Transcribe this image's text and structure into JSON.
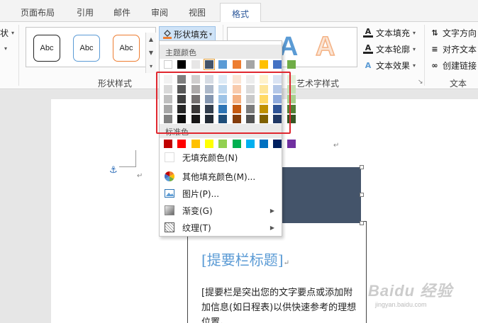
{
  "tabs": [
    {
      "label": "页面布局"
    },
    {
      "label": "引用"
    },
    {
      "label": "邮件"
    },
    {
      "label": "审阅"
    },
    {
      "label": "视图"
    },
    {
      "label": "格式"
    }
  ],
  "ribbon": {
    "left_fragment": "状",
    "shape_styles": {
      "label": "形状样式",
      "buttons": [
        {
          "text": "Abc",
          "border": "#222222"
        },
        {
          "text": "Abc",
          "border": "#5b9bd5"
        },
        {
          "text": "Abc",
          "border": "#ed7d31"
        }
      ],
      "fill_button": "形状填充"
    },
    "wordart": {
      "label": "艺术字样式",
      "letters": [
        {
          "char": "A",
          "color": "#5b9bd5"
        },
        {
          "char": "A",
          "color": "#f4b183"
        }
      ],
      "text_fill": "文本填充",
      "text_outline": "文本轮廓",
      "text_effects": "文本效果"
    },
    "text_group": {
      "label": "文本",
      "direction": "文字方向",
      "align": "对齐文本",
      "link": "创建链接"
    }
  },
  "dropdown": {
    "theme_colors_label": "主题颜色",
    "theme_colors": [
      "#ffffff",
      "#000000",
      "#e7e6e6",
      "#44546a",
      "#5b9bd5",
      "#ed7d31",
      "#a5a5a5",
      "#ffc000",
      "#4472c4",
      "#70ad47"
    ],
    "selected_theme_index": 3,
    "shades": [
      [
        "#f2f2f2",
        "#d9d9d9",
        "#bfbfbf",
        "#a6a6a6",
        "#808080"
      ],
      [
        "#7f7f7f",
        "#595959",
        "#404040",
        "#262626",
        "#0d0d0d"
      ],
      [
        "#d0cece",
        "#aeabab",
        "#757171",
        "#3a3838",
        "#171616"
      ],
      [
        "#d6dce4",
        "#adb9ca",
        "#8496b0",
        "#333f4f",
        "#222a35"
      ],
      [
        "#deebf6",
        "#bdd7ee",
        "#9dc3e6",
        "#2e75b5",
        "#1f4e79"
      ],
      [
        "#fbe5d5",
        "#f8cbad",
        "#f4b183",
        "#c55a11",
        "#833c0b"
      ],
      [
        "#ededed",
        "#dbdbdb",
        "#c9c9c9",
        "#7b7b7b",
        "#525252"
      ],
      [
        "#fff2cc",
        "#fee599",
        "#ffd965",
        "#bf9000",
        "#7f6000"
      ],
      [
        "#dae3f3",
        "#b4c7e7",
        "#8faadc",
        "#2f5496",
        "#203864"
      ],
      [
        "#e2efd9",
        "#c5e0b3",
        "#a8d08d",
        "#538135",
        "#375623"
      ]
    ],
    "standard_label": "标准色",
    "standard_colors": [
      "#c00000",
      "#ff0000",
      "#ffc000",
      "#ffff00",
      "#92d050",
      "#00b050",
      "#00b0f0",
      "#0070c0",
      "#002060",
      "#7030a0"
    ],
    "items": [
      {
        "label": "无填充颜色(N)"
      },
      {
        "label": "其他填充颜色(M)..."
      },
      {
        "label": "图片(P)..."
      },
      {
        "label": "渐变(G)"
      },
      {
        "label": "纹理(T)"
      }
    ]
  },
  "document": {
    "sidebar_title": "[提要栏标题]",
    "sidebar_body": "[提要栏是突出您的文字要点或添加附加信息(如日程表)以供快速参考的理想位置。",
    "shape_color": "#44546a"
  },
  "watermark": {
    "brand": "Baidu 经验",
    "sub": "jingyan.baidu.com"
  }
}
